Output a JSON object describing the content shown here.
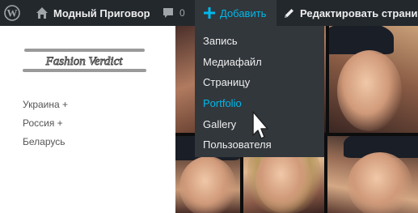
{
  "adminbar": {
    "site_name": "Модный Приговор",
    "comments_count": "0",
    "new_label": "Добавить",
    "edit_label": "Редактировать страни"
  },
  "new_menu": {
    "items": [
      {
        "label": "Запись"
      },
      {
        "label": "Медиафайл"
      },
      {
        "label": "Страницу"
      },
      {
        "label": "Portfolio"
      },
      {
        "label": "Gallery"
      },
      {
        "label": "Пользователя"
      }
    ],
    "hovered_index": 3
  },
  "logo": {
    "text": "Fashion Verdict"
  },
  "sidebar_nav": {
    "items": [
      {
        "label": "Украина +"
      },
      {
        "label": "Россия +"
      },
      {
        "label": "Беларусь"
      }
    ]
  },
  "colors": {
    "adminbar_bg": "#23282d",
    "menu_bg": "#32373c",
    "accent": "#00b9eb",
    "text_light": "#eeeeee",
    "nav_text": "#555555"
  },
  "icons": {
    "wp": "wordpress-logo-icon",
    "site": "home-icon",
    "comments": "comment-bubble-icon",
    "new": "plus-icon",
    "edit": "pencil-icon"
  }
}
